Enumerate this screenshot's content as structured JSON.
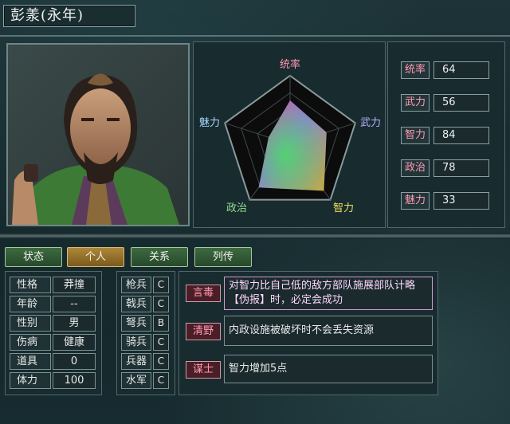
{
  "officer": {
    "name": "彭羕(永年)"
  },
  "radar": {
    "labels": {
      "tongshuai": "统率",
      "wuli": "武力",
      "zhili": "智力",
      "zhengzhi": "政治",
      "meili": "魅力"
    }
  },
  "stats": [
    {
      "label": "统率",
      "value": "64",
      "num": 64
    },
    {
      "label": "武力",
      "value": "56",
      "num": 56
    },
    {
      "label": "智力",
      "value": "84",
      "num": 84
    },
    {
      "label": "政治",
      "value": "78",
      "num": 78
    },
    {
      "label": "魅力",
      "value": "33",
      "num": 33
    }
  ],
  "stat_max": 100,
  "tabs": [
    {
      "label": "状态"
    },
    {
      "label": "个人"
    },
    {
      "label": "关系"
    },
    {
      "label": "列传"
    }
  ],
  "personal": [
    {
      "label": "性格",
      "value": "莽撞"
    },
    {
      "label": "年龄",
      "value": "--"
    },
    {
      "label": "性别",
      "value": "男"
    },
    {
      "label": "伤病",
      "value": "健康"
    },
    {
      "label": "道具",
      "value": "0"
    },
    {
      "label": "体力",
      "value": "100"
    }
  ],
  "troops": [
    {
      "label": "枪兵",
      "grade": "C"
    },
    {
      "label": "戟兵",
      "grade": "C"
    },
    {
      "label": "弩兵",
      "grade": "B"
    },
    {
      "label": "骑兵",
      "grade": "C"
    },
    {
      "label": "兵器",
      "grade": "C"
    },
    {
      "label": "水军",
      "grade": "C"
    }
  ],
  "skills": [
    {
      "name": "言毒",
      "desc": "对智力比自己低的敌方部队施展部队计略【伪报】时，必定会成功"
    },
    {
      "name": "清野",
      "desc": "内政设施被破坏时不会丢失资源"
    },
    {
      "name": "谋士",
      "desc": "智力增加5点"
    }
  ],
  "colors": {
    "accent_pink": "#ff9ab4",
    "tab_active": "#ad8839",
    "tab_inactive": "#3e6a40"
  }
}
